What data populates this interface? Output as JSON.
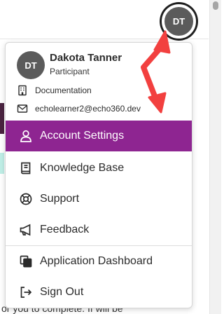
{
  "header": {
    "avatar_initials": "DT"
  },
  "background": {
    "bottom_text": "or you to complete. If will be"
  },
  "profile": {
    "initials": "DT",
    "name": "Dakota Tanner",
    "role": "Participant",
    "organization": "Documentation",
    "email": "echolearner2@echo360.dev"
  },
  "menu": {
    "items": [
      {
        "label": "Account Settings",
        "icon": "user-icon",
        "active": true
      },
      {
        "label": "Knowledge Base",
        "icon": "book-icon",
        "active": false
      },
      {
        "label": "Support",
        "icon": "lifebuoy-icon",
        "active": false
      },
      {
        "label": "Feedback",
        "icon": "megaphone-icon",
        "active": false
      },
      {
        "label": "Application Dashboard",
        "icon": "copy-icon",
        "active": false
      },
      {
        "label": "Sign Out",
        "icon": "sign-out-icon",
        "active": false
      }
    ]
  },
  "colors": {
    "accent": "#8e2591",
    "avatar_bg": "#5b5b5b",
    "annotation_arrow": "#f2403f"
  }
}
